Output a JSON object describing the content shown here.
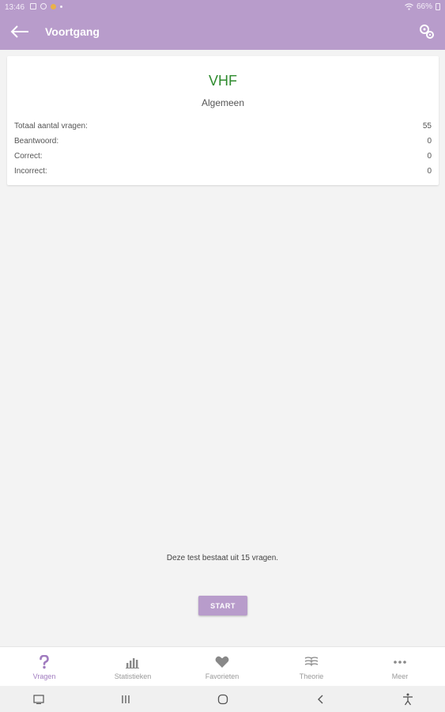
{
  "status_bar": {
    "time": "13:46",
    "battery": "66%"
  },
  "app_bar": {
    "title": "Voortgang",
    "back_icon": "arrow-left-icon",
    "settings_icon": "settings-icon"
  },
  "card": {
    "heading": "VHF",
    "subheading": "Algemeen",
    "stats": [
      {
        "label": "Totaal aantal vragen:",
        "value": "55"
      },
      {
        "label": "Beantwoord:",
        "value": "0"
      },
      {
        "label": "Correct:",
        "value": "0"
      },
      {
        "label": "Incorrect:",
        "value": "0"
      }
    ]
  },
  "test_info": "Deze test bestaat uit 15 vragen.",
  "start_label": "START",
  "bottom_nav": [
    {
      "label": "Vragen",
      "icon": "question-icon",
      "active": true
    },
    {
      "label": "Statistieken",
      "icon": "bar-chart-icon",
      "active": false
    },
    {
      "label": "Favorieten",
      "icon": "heart-icon",
      "active": false
    },
    {
      "label": "Theorie",
      "icon": "book-icon",
      "active": false
    },
    {
      "label": "Meer",
      "icon": "more-icon",
      "active": false
    }
  ],
  "colors": {
    "primary": "#b89ccb",
    "heading_green": "#2e8b2e",
    "active_nav": "#a07bbf",
    "background": "#f3f3f3"
  }
}
